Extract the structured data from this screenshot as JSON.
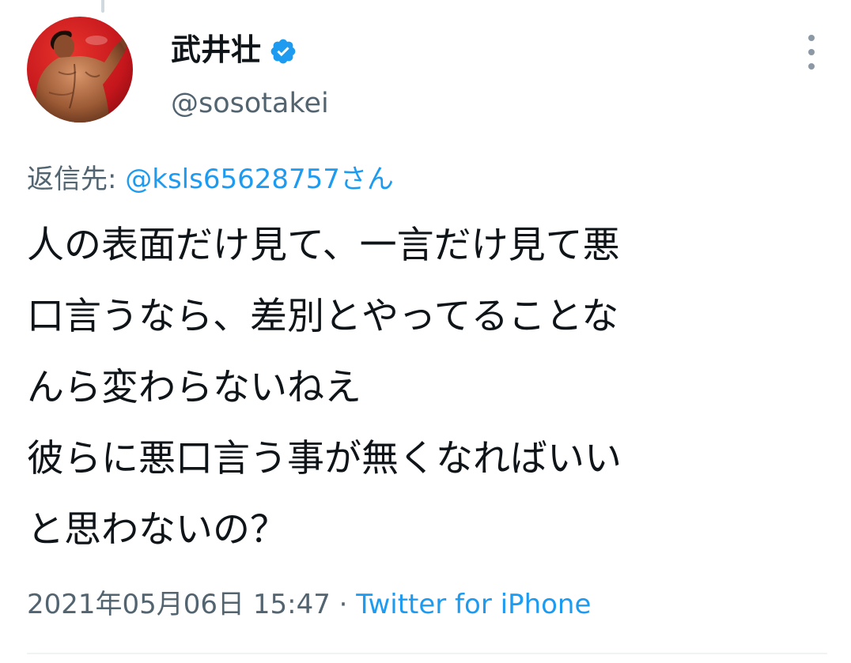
{
  "tweet": {
    "display_name": "武井壮",
    "handle": "@sosotakei",
    "verified": true,
    "reply": {
      "prefix": "返信先: ",
      "mention": "@ksls65628757さん"
    },
    "text_lines": [
      "人の表面だけ見て、一言だけ見て悪",
      "口言うなら、差別とやってることな",
      "んら変わらないねえ",
      "彼らに悪口言う事が無くなればいい",
      "と思わないの？"
    ],
    "timestamp": "2021年05月06日 15:47",
    "separator": " · ",
    "source": "Twitter for iPhone"
  },
  "icons": {
    "verified": "verified-badge-icon",
    "more": "more-vertical-icon"
  },
  "colors": {
    "accent": "#1d9bf0",
    "secondary_text": "#536471",
    "primary_text": "#0f1419",
    "avatar_background": "#d01b1b"
  }
}
